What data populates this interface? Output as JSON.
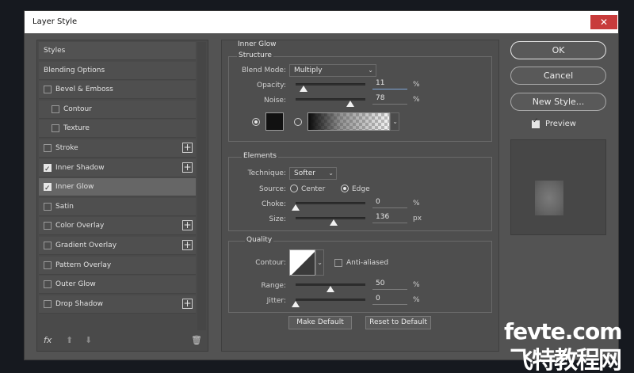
{
  "window": {
    "title": "Layer Style",
    "close_label": "✕"
  },
  "styles_panel": {
    "items": [
      {
        "label": "Styles",
        "checkbox": false,
        "checked": false,
        "plus": false,
        "indent": 0
      },
      {
        "label": "Blending Options",
        "checkbox": false,
        "checked": false,
        "plus": false,
        "indent": 0
      },
      {
        "label": "Bevel & Emboss",
        "checkbox": true,
        "checked": false,
        "plus": false,
        "indent": 0
      },
      {
        "label": "Contour",
        "checkbox": true,
        "checked": false,
        "plus": false,
        "indent": 1
      },
      {
        "label": "Texture",
        "checkbox": true,
        "checked": false,
        "plus": false,
        "indent": 1
      },
      {
        "label": "Stroke",
        "checkbox": true,
        "checked": false,
        "plus": true,
        "indent": 0
      },
      {
        "label": "Inner Shadow",
        "checkbox": true,
        "checked": true,
        "plus": true,
        "indent": 0
      },
      {
        "label": "Inner Glow",
        "checkbox": true,
        "checked": true,
        "plus": false,
        "indent": 0,
        "selected": true
      },
      {
        "label": "Satin",
        "checkbox": true,
        "checked": false,
        "plus": false,
        "indent": 0
      },
      {
        "label": "Color Overlay",
        "checkbox": true,
        "checked": false,
        "plus": true,
        "indent": 0
      },
      {
        "label": "Gradient Overlay",
        "checkbox": true,
        "checked": false,
        "plus": true,
        "indent": 0
      },
      {
        "label": "Pattern Overlay",
        "checkbox": true,
        "checked": false,
        "plus": false,
        "indent": 0
      },
      {
        "label": "Outer Glow",
        "checkbox": true,
        "checked": false,
        "plus": false,
        "indent": 0
      },
      {
        "label": "Drop Shadow",
        "checkbox": true,
        "checked": false,
        "plus": true,
        "indent": 0
      }
    ],
    "tools": {
      "fx": "fx",
      "up": "⬆",
      "down": "⬇",
      "trash": "🗑"
    }
  },
  "inner_glow": {
    "title": "Inner Glow",
    "structure": {
      "title": "Structure",
      "blend_mode_label": "Blend Mode:",
      "blend_mode_value": "Multiply",
      "opacity_label": "Opacity:",
      "opacity_value": "11",
      "opacity_unit": "%",
      "opacity_fraction": 0.11,
      "noise_label": "Noise:",
      "noise_value": "78",
      "noise_unit": "%",
      "noise_fraction": 0.78,
      "color_swatch": "#111111"
    },
    "elements": {
      "title": "Elements",
      "technique_label": "Technique:",
      "technique_value": "Softer",
      "source_label": "Source:",
      "source_center": "Center",
      "source_edge": "Edge",
      "choke_label": "Choke:",
      "choke_value": "0",
      "choke_unit": "%",
      "choke_fraction": 0.0,
      "size_label": "Size:",
      "size_value": "136",
      "size_unit": "px",
      "size_fraction": 0.54
    },
    "quality": {
      "title": "Quality",
      "contour_label": "Contour:",
      "anti_aliased_label": "Anti-aliased",
      "range_label": "Range:",
      "range_value": "50",
      "range_unit": "%",
      "range_fraction": 0.5,
      "jitter_label": "Jitter:",
      "jitter_value": "0",
      "jitter_unit": "%",
      "jitter_fraction": 0.0
    },
    "make_default": "Make Default",
    "reset_default": "Reset to Default"
  },
  "actions": {
    "ok": "OK",
    "cancel": "Cancel",
    "new_style": "New Style...",
    "preview_label": "Preview",
    "preview_checked": true
  },
  "watermark": {
    "line1": "fevte.com",
    "line2": "飞特教程网"
  }
}
